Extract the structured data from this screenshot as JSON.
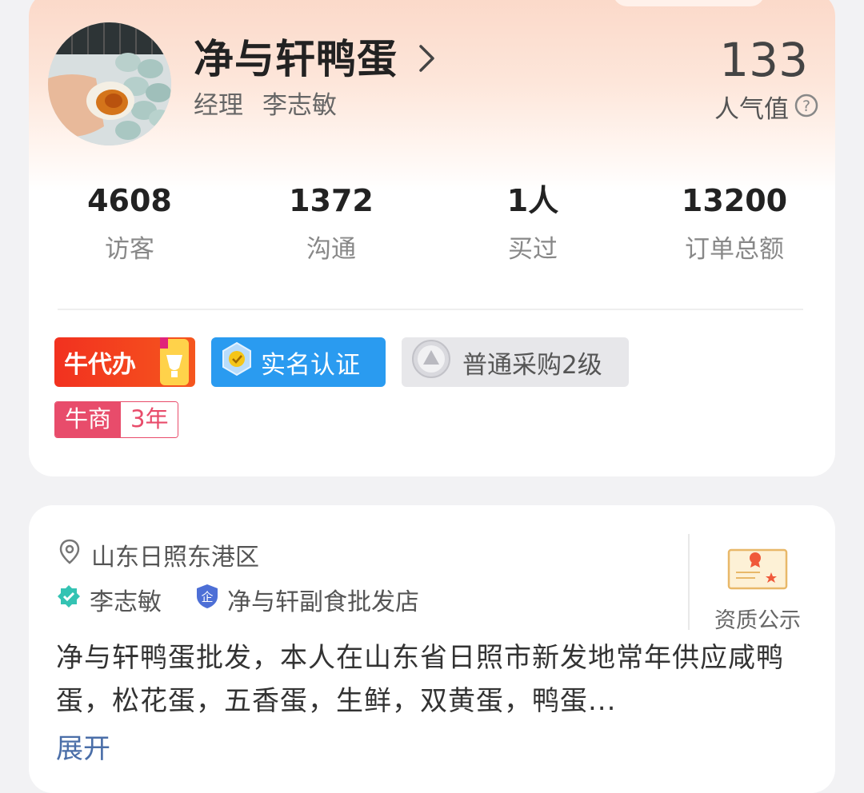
{
  "profile": {
    "shop_name": "净与轩鸭蛋",
    "role": "经理",
    "person": "李志敏",
    "popularity_value": "133",
    "popularity_label": "人气值"
  },
  "stats": [
    {
      "value": "4608",
      "label": "访客"
    },
    {
      "value": "1372",
      "label": "沟通"
    },
    {
      "value": "1人",
      "label": "买过"
    },
    {
      "value": "13200",
      "label": "订单总额"
    }
  ],
  "badges": {
    "niu_daiban": "牛代办",
    "real_name": "实名认证",
    "buyer_level": "普通采购2级",
    "niu_shang": "牛商",
    "niu_shang_years": "3年"
  },
  "details": {
    "location": "山东日照东港区",
    "person_name": "李志敏",
    "company": "净与轩副食批发店",
    "certificate_label": "资质公示",
    "description": "净与轩鸭蛋批发，本人在山东省日照市新发地常年供应咸鸭蛋，松花蛋，五香蛋，生鲜，双黄蛋，鸭蛋...",
    "expand_label": "展开"
  },
  "colors": {
    "accent_red": "#f2311f",
    "verify_blue": "#2a9bf0",
    "niu_shang_pink": "#e84c6b",
    "link_blue": "#4a6ea8"
  },
  "icons": {
    "chevron": "chevron-right-icon",
    "help": "question-circle-icon",
    "location": "location-pin-icon",
    "verified": "verified-badge-icon",
    "enterprise": "enterprise-shield-icon",
    "certificate": "certificate-icon"
  }
}
